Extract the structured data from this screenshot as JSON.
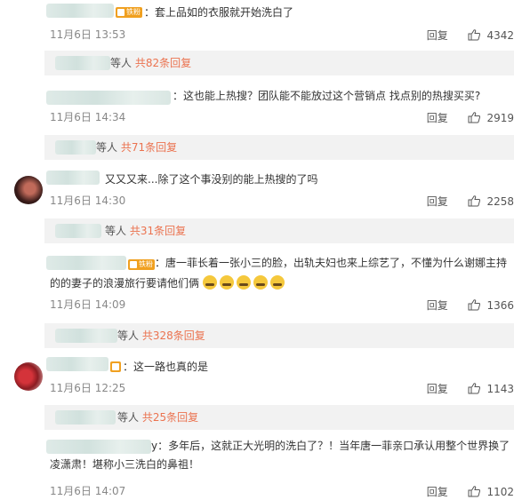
{
  "comments": [
    {
      "badge": "铁粉",
      "text": "：套上品如的衣服就开始洗白了",
      "time": "11月6日 13:53",
      "reply": "回复",
      "likes": "4342",
      "sub": {
        "prefix": "等人",
        "link": "共82条回复"
      }
    },
    {
      "text": "：这也能上热搜？团队能不能放过这个营销点 找点别的热搜买买?",
      "time": "11月6日 14:34",
      "reply": "回复",
      "likes": "2919",
      "sub": {
        "prefix": "等人",
        "link": "共71条回复"
      }
    },
    {
      "text": "又又又来...除了这个事没别的能上热搜的了吗",
      "time": "11月6日 14:30",
      "reply": "回复",
      "likes": "2258",
      "sub": {
        "prefix": "等人",
        "link": "共31条回复"
      }
    },
    {
      "badge": "铁粉",
      "text_line1": "：唐一菲长着一张小三的脸，出轨夫妇也来上综艺了，不懂为什么谢娜主持",
      "text_line2": "的的妻子的浪漫旅行要请他们俩",
      "time": "11月6日 14:09",
      "reply": "回复",
      "likes": "1366",
      "sub": {
        "prefix": "等人",
        "link": "共328条回复"
      }
    },
    {
      "text": "：这一路也真的是",
      "time": "11月6日 12:25",
      "reply": "回复",
      "likes": "1143",
      "sub": {
        "prefix": "等人",
        "link": "共25条回复"
      }
    },
    {
      "text_line1": "y：多年后，这就正大光明的洗白了？！当年唐一菲亲口承认用整个世界换了",
      "text_line2": "凌潇肃！堪称小三洗白的鼻祖！",
      "time": "11月6日 14:07",
      "reply": "回复",
      "likes": "1102"
    }
  ]
}
